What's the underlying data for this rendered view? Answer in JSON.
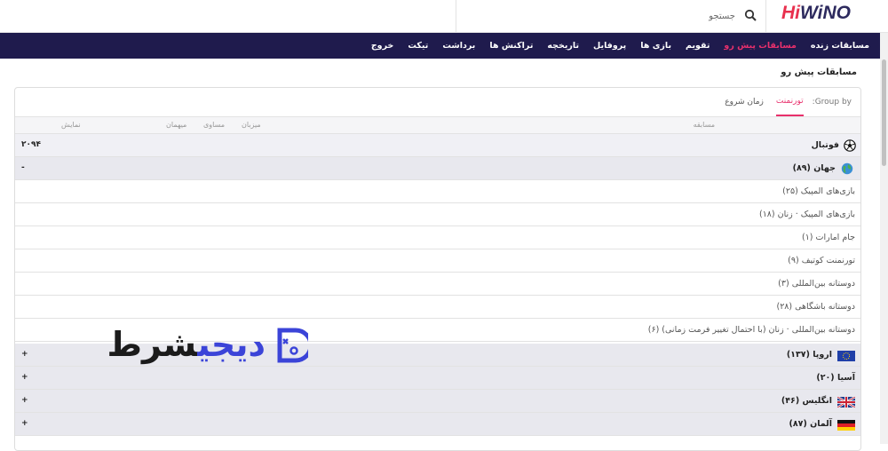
{
  "brand": {
    "logo_hi": "Hi",
    "logo_rest": "WiNO"
  },
  "search": {
    "placeholder": "جستجو"
  },
  "nav": [
    {
      "label": "مسابقات زنده",
      "active": false
    },
    {
      "label": "مسابقات پیش رو",
      "active": true
    },
    {
      "label": "تقویم",
      "active": false
    },
    {
      "label": "بازی ها",
      "active": false
    },
    {
      "label": "پروفایل",
      "active": false
    },
    {
      "label": "تاریخچه",
      "active": false
    },
    {
      "label": "تراکنش ها",
      "active": false
    },
    {
      "label": "برداشت",
      "active": false
    },
    {
      "label": "تیکت",
      "active": false
    },
    {
      "label": "خروج",
      "active": false
    }
  ],
  "page": {
    "title": "مسابقات پیش رو"
  },
  "groupby": {
    "label": "Group by:",
    "options": [
      "تورنمنت",
      "زمان شروع"
    ],
    "active": "تورنمنت"
  },
  "table_header": {
    "competition": "مسابقه",
    "home": "میزبان",
    "draw": "مساوی",
    "away": "میهمان",
    "display": "نمایش"
  },
  "sport": {
    "name": "فوتبال",
    "count": "۲۰۹۴",
    "icon": "soccer-ball-icon"
  },
  "region_world": {
    "name": "جهان (۸۹)",
    "toggle": "-",
    "icon": "globe-icon"
  },
  "leagues": [
    "بازی‌های المپیک (۲۵)",
    "بازی‌های المپیک · زنان (۱۸)",
    "جام امارات (۱)",
    "تورنمنت کوتیف (۹)",
    "دوستانه بین‌المللی (۳)",
    "دوستانه باشگاهی (۲۸)",
    "دوستانه بین‌المللی · زنان (با احتمال تغییر فرمت زمانی) (۶)"
  ],
  "regions": [
    {
      "name": "اروپا (۱۳۷)",
      "toggle": "+",
      "icon": "eu-flag-icon"
    },
    {
      "name": "آسیا (۲۰)",
      "toggle": "+",
      "icon": ""
    },
    {
      "name": "انگلیس (۴۶)",
      "toggle": "+",
      "icon": "uk-flag-icon"
    },
    {
      "name": "آلمان (۸۷)",
      "toggle": "+",
      "icon": "germany-flag-icon"
    }
  ],
  "watermark": {
    "part_a": "شرط",
    "part_b": "دیجی"
  },
  "colors": {
    "nav_bg": "#1f1b4d",
    "accent": "#e8306c",
    "watermark_blue": "#3b44d8"
  }
}
